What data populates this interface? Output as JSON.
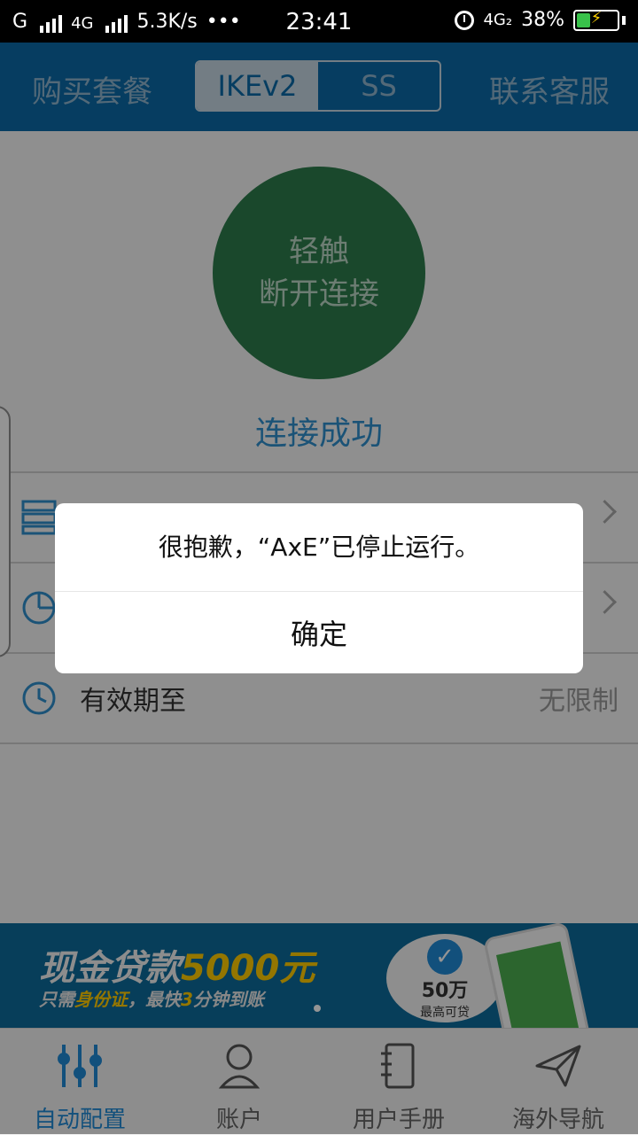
{
  "status_bar": {
    "carrier": "G",
    "network_type": "4G",
    "speed": "5.3K/s",
    "more": "•••",
    "time": "23:41",
    "network_right": "4G₂",
    "battery_percent": "38%",
    "battery_level": 0.38
  },
  "header": {
    "left_label": "购买套餐",
    "segments": [
      "IKEv2",
      "SS"
    ],
    "active_segment": "IKEv2",
    "right_label": "联系客服"
  },
  "connect_button": {
    "line1": "轻触",
    "line2": "断开连接"
  },
  "connection_status": "连接成功",
  "info_rows": [
    {
      "label": "",
      "value": ""
    },
    {
      "label": "",
      "value": ""
    },
    {
      "label": "有效期至",
      "value": "无限制"
    }
  ],
  "dialog": {
    "message": "很抱歉，“AxE”已停止运行。",
    "confirm_label": "确定"
  },
  "banner": {
    "headline_a": "现金贷款",
    "headline_b": "5000元",
    "sub_a": "只需",
    "sub_b": "身份证",
    "sub_c": "，最快",
    "sub_d": "3",
    "sub_e": "分钟到账",
    "bubble_amount": "50万",
    "bubble_sub": "最高可贷"
  },
  "tabbar": {
    "items": [
      {
        "label": "自动配置",
        "icon": "sliders-icon",
        "active": true
      },
      {
        "label": "账户",
        "icon": "user-icon",
        "active": false
      },
      {
        "label": "用户手册",
        "icon": "notebook-icon",
        "active": false
      },
      {
        "label": "海外导航",
        "icon": "paper-plane-icon",
        "active": false
      }
    ]
  },
  "colors": {
    "header": "#0b6aa8",
    "accent": "#1f8ad6",
    "connect_circle": "#2d7d4c"
  }
}
